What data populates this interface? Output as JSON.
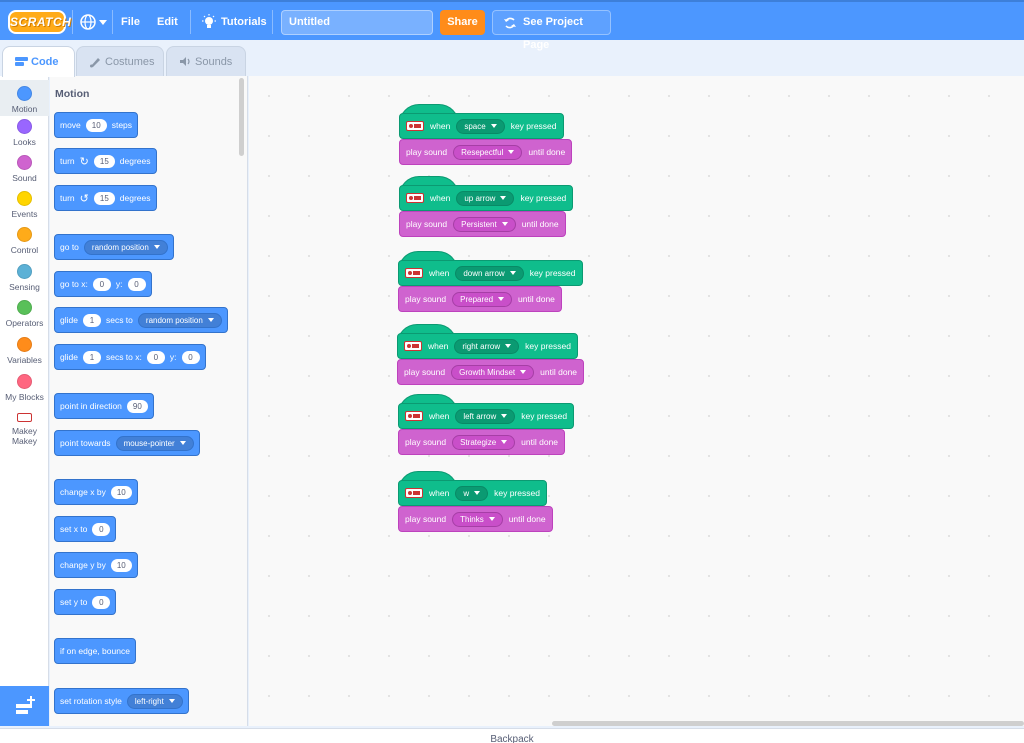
{
  "menubar": {
    "logo": "SCRATCH",
    "file": "File",
    "edit": "Edit",
    "tutorials": "Tutorials",
    "project_title": "Untitled",
    "share": "Share",
    "see_project_page": "See Project Page"
  },
  "tabs": [
    {
      "label": "Code"
    },
    {
      "label": "Costumes"
    },
    {
      "label": "Sounds"
    }
  ],
  "categories": [
    {
      "label": "Motion",
      "color": "#4c97ff"
    },
    {
      "label": "Looks",
      "color": "#9966ff"
    },
    {
      "label": "Sound",
      "color": "#cf63cf"
    },
    {
      "label": "Events",
      "color": "#ffd500"
    },
    {
      "label": "Control",
      "color": "#ffab19"
    },
    {
      "label": "Sensing",
      "color": "#5cb1d6"
    },
    {
      "label": "Operators",
      "color": "#59c059"
    },
    {
      "label": "Variables",
      "color": "#ff8c1a"
    },
    {
      "label": "My Blocks",
      "color": "#ff6680"
    },
    {
      "label": "Makey Makey",
      "color": "#ffffff"
    }
  ],
  "palette": {
    "title": "Motion",
    "move": {
      "a": "move",
      "n": "10",
      "b": "steps"
    },
    "turn_cw": {
      "a": "turn",
      "n": "15",
      "b": "degrees"
    },
    "turn_ccw": {
      "a": "turn",
      "n": "15",
      "b": "degrees"
    },
    "goto": {
      "a": "go to",
      "d": "random position"
    },
    "goto_xy": {
      "a": "go to x:",
      "x": "0",
      "b": "y:",
      "y": "0"
    },
    "glide_to": {
      "a": "glide",
      "n": "1",
      "b": "secs to",
      "d": "random position"
    },
    "glide_xy": {
      "a": "glide",
      "n": "1",
      "b": "secs to x:",
      "x": "0",
      "c": "y:",
      "y": "0"
    },
    "point_dir": {
      "a": "point in direction",
      "n": "90"
    },
    "point_towards": {
      "a": "point towards",
      "d": "mouse-pointer"
    },
    "change_x": {
      "a": "change x by",
      "n": "10"
    },
    "set_x": {
      "a": "set x to",
      "n": "0"
    },
    "change_y": {
      "a": "change y by",
      "n": "10"
    },
    "set_y": {
      "a": "set y to",
      "n": "0"
    },
    "bounce": {
      "a": "if on edge, bounce"
    },
    "rotation": {
      "a": "set rotation style",
      "d": "left-right"
    }
  },
  "scripts": [
    {
      "when": "when",
      "key": "space",
      "pressed": "key pressed",
      "play": "play sound",
      "sound": "Resepectful",
      "until": "until done"
    },
    {
      "when": "when",
      "key": "up arrow",
      "pressed": "key pressed",
      "play": "play sound",
      "sound": "Persistent",
      "until": "until done"
    },
    {
      "when": "when",
      "key": "down arrow",
      "pressed": "key pressed",
      "play": "play sound",
      "sound": "Prepared",
      "until": "until done"
    },
    {
      "when": "when",
      "key": "right arrow",
      "pressed": "key pressed",
      "play": "play sound",
      "sound": "Growth Mindset",
      "until": "until done"
    },
    {
      "when": "when",
      "key": "left arrow",
      "pressed": "key pressed",
      "play": "play sound",
      "sound": "Strategize",
      "until": "until done"
    },
    {
      "when": "when",
      "key": "w",
      "pressed": "key pressed",
      "play": "play sound",
      "sound": "Thinks",
      "until": "until done"
    }
  ],
  "backpack": "Backpack",
  "colors": {
    "motion": "#4c97ff",
    "events_makey": "#0fbd8c",
    "sound": "#cf63cf",
    "menubar": "#4c97ff",
    "share": "#ff8c1a"
  }
}
